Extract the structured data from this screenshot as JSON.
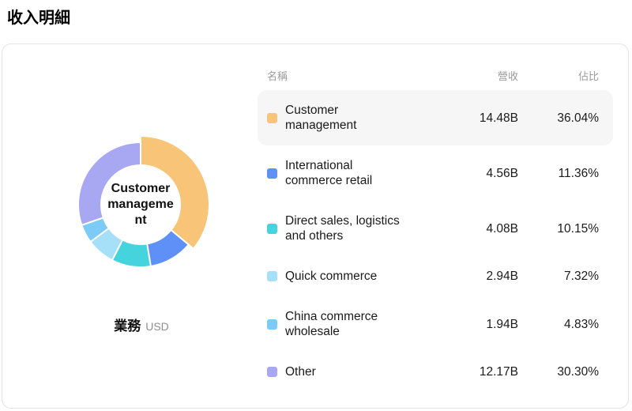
{
  "page": {
    "title": "收入明細"
  },
  "chart": {
    "center_label": "Customer management",
    "axis_label": "業務",
    "unit_label": "USD"
  },
  "table": {
    "headers": {
      "name": "名稱",
      "revenue": "營收",
      "share": "佔比"
    },
    "rows": [
      {
        "name": "Customer management",
        "revenue": "14.48B",
        "share": "36.04%",
        "color": "#F8C478",
        "selected": true
      },
      {
        "name": "International commerce retail",
        "revenue": "4.56B",
        "share": "11.36%",
        "color": "#5E90F7",
        "selected": false
      },
      {
        "name": "Direct sales, logistics and others",
        "revenue": "4.08B",
        "share": "10.15%",
        "color": "#45D4DE",
        "selected": false
      },
      {
        "name": "Quick commerce",
        "revenue": "2.94B",
        "share": "7.32%",
        "color": "#A6DFF8",
        "selected": false
      },
      {
        "name": "China commerce wholesale",
        "revenue": "1.94B",
        "share": "4.83%",
        "color": "#7CCBF7",
        "selected": false
      },
      {
        "name": "Other",
        "revenue": "12.17B",
        "share": "30.30%",
        "color": "#A8A7F2",
        "selected": false
      }
    ]
  },
  "chart_data": {
    "type": "pie",
    "title": "收入明細",
    "categories": [
      "Customer management",
      "International commerce retail",
      "Direct sales, logistics and others",
      "Quick commerce",
      "China commerce wholesale",
      "Other"
    ],
    "values": [
      14.48,
      4.56,
      4.08,
      2.94,
      1.94,
      12.17
    ],
    "percents": [
      36.04,
      11.36,
      10.15,
      7.32,
      4.83,
      30.3
    ],
    "value_unit": "B",
    "currency": "USD",
    "colors": [
      "#F8C478",
      "#5E90F7",
      "#45D4DE",
      "#A6DFF8",
      "#7CCBF7",
      "#A8A7F2"
    ],
    "donut": true,
    "selected_index": 0,
    "selected_label": "Customer management",
    "start_angle_deg": 0,
    "clockwise": true,
    "legend_position": "right-table"
  }
}
